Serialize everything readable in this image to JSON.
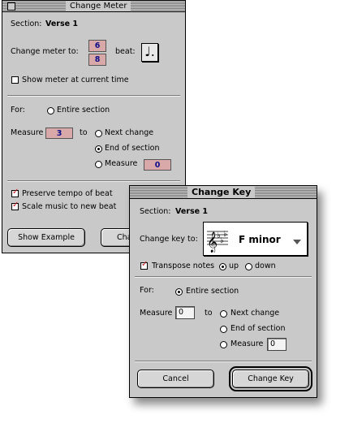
{
  "change_meter": {
    "title": "Change Meter",
    "section_label": "Section:",
    "section_value": "Verse 1",
    "change_meter_label": "Change meter to:",
    "meter_top": "6",
    "meter_bottom": "8",
    "beat_label": "beat:",
    "beat_icon": "dotted-quarter-note",
    "beat_glyph": "♩.",
    "show_meter_label": "Show meter at current time",
    "show_meter_checked": false,
    "for_label": "For:",
    "entire_section_label": "Entire section",
    "measure_label": "Measure",
    "measure_value": "3",
    "to_label": "to",
    "next_change_label": "Next change",
    "end_of_section_label": "End of section",
    "measure_option_label": "Measure",
    "measure_option_value": "0",
    "preserve_tempo_label": "Preserve tempo of beat",
    "scale_music_label": "Scale music to new beat",
    "show_example_button": "Show Example",
    "cancel_button": "Cha"
  },
  "change_key": {
    "title": "Change Key",
    "section_label": "Section:",
    "section_value": "Verse 1",
    "change_key_label": "Change key to:",
    "key_value": "F minor",
    "key_icon": "key-signature-icon",
    "transpose_label": "Transpose notes",
    "up_label": "up",
    "down_label": "down",
    "for_label": "For:",
    "entire_section_label": "Entire section",
    "measure_label": "Measure",
    "measure_value": "0",
    "to_label": "to",
    "next_change_label": "Next change",
    "end_of_section_label": "End of section",
    "measure_option_label": "Measure",
    "measure_option_value": "0",
    "cancel_button": "Cancel",
    "ok_button": "Change Key"
  },
  "colors": {
    "window_bg": "#c9c9c9",
    "field_bg": "#d9a8a8",
    "field_text": "#0d0d8a",
    "check_mark": "#c81e1e"
  }
}
